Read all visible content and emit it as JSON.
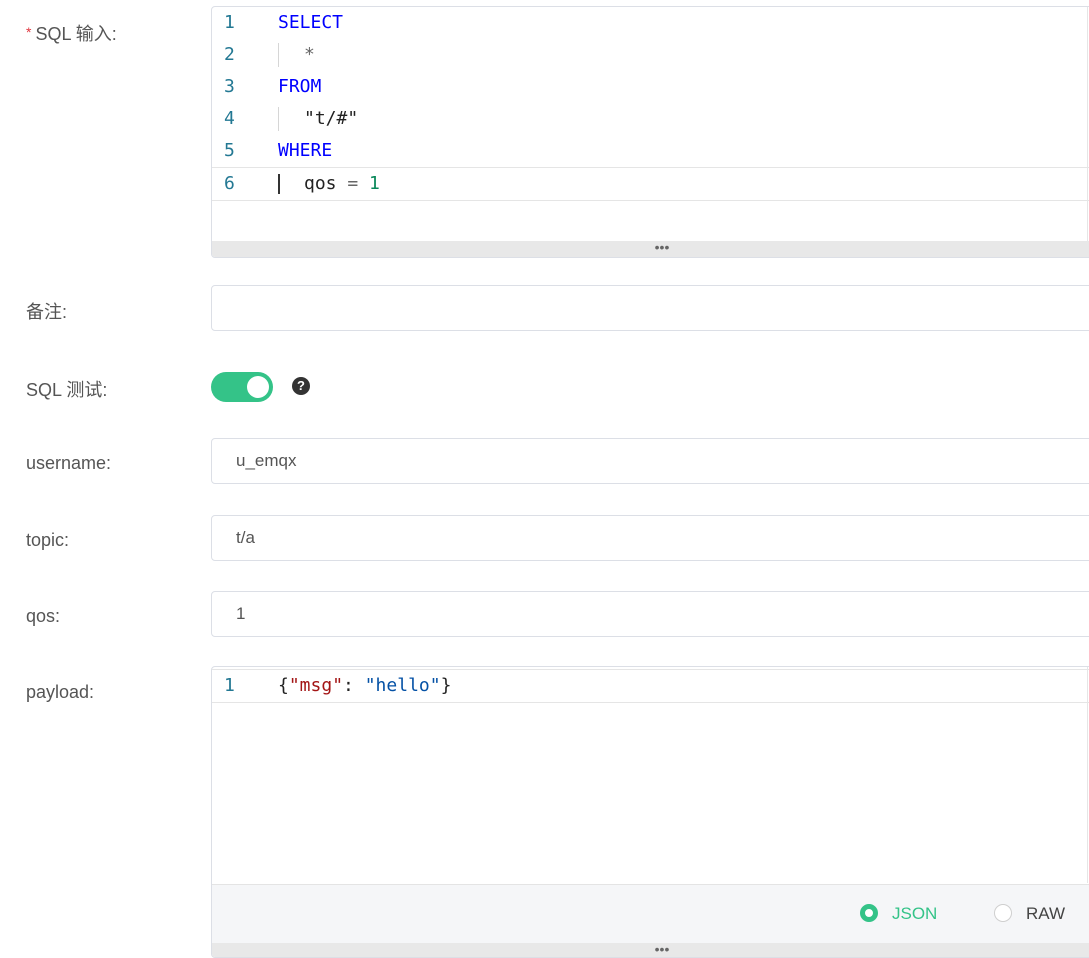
{
  "form": {
    "sql_label": "SQL 输入:",
    "required_mark": "*",
    "note_label": "备注:",
    "note_value": "",
    "test_label": "SQL 测试:",
    "test_enabled": true,
    "help_icon": "?",
    "username_label": "username:",
    "username_value": "u_emqx",
    "topic_label": "topic:",
    "topic_value": "t/a",
    "qos_label": "qos:",
    "qos_value": "1",
    "payload_label": "payload:"
  },
  "sql_editor": {
    "line_numbers": [
      "1",
      "2",
      "3",
      "4",
      "5",
      "6"
    ],
    "lines": {
      "l1": "SELECT",
      "l2": "*",
      "l3": "FROM",
      "l4": "\"t/#\"",
      "l5": "WHERE",
      "l6_field": "qos",
      "l6_op": "=",
      "l6_value": "1"
    },
    "resize_handle": "•••"
  },
  "payload_editor": {
    "line_number": "1",
    "brace_open": "{",
    "key": "\"msg\"",
    "colon": ": ",
    "value": "\"hello\"",
    "brace_close": "}",
    "formats": [
      "JSON",
      "RAW"
    ],
    "selected_format": "JSON",
    "resize_handle": "•••"
  },
  "colors": {
    "accent": "#34c388",
    "required": "#e0353e",
    "keyword": "#0000ff",
    "number": "#09885a",
    "line_number": "#237893"
  }
}
